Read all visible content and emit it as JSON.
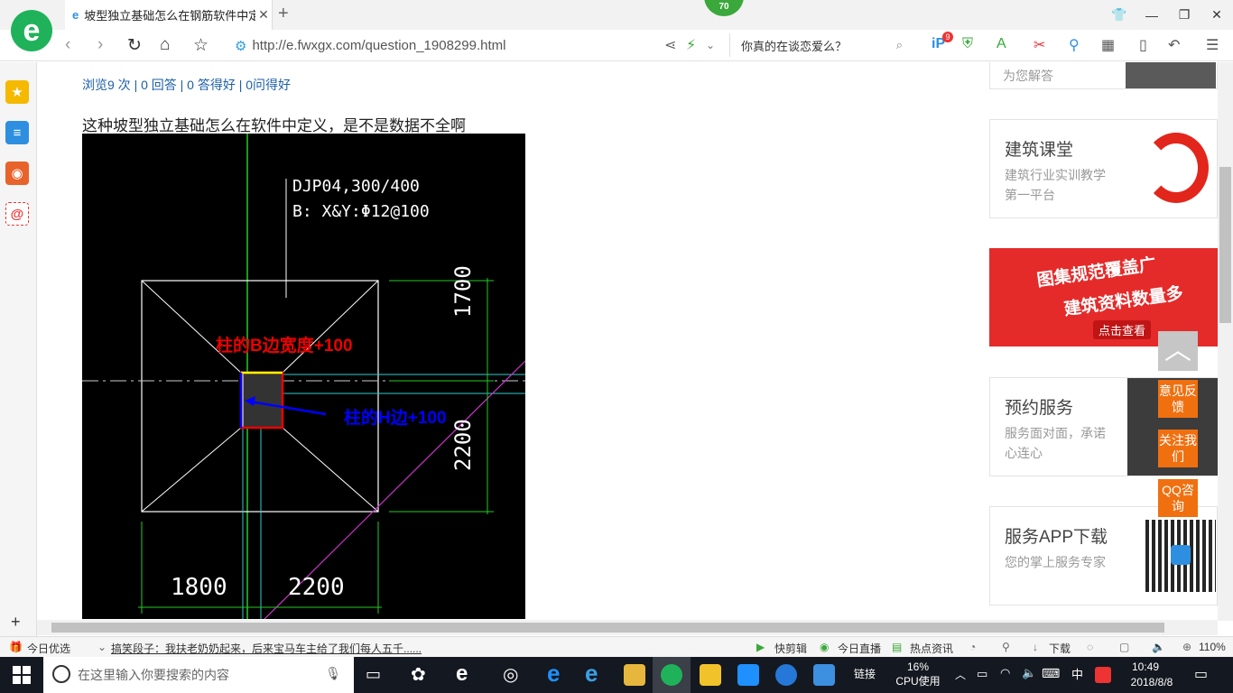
{
  "browser": {
    "tab_title": "坡型独立基础怎么在钢筋软件中定",
    "score_badge": "70",
    "url": "http://e.fwxgx.com/question_1908299.html",
    "search_placeholder": "你真的在谈恋爱么？",
    "notif_count": "9"
  },
  "page": {
    "stats": "浏览9 次 | 0 回答 | 0 答得好 | 0问得好",
    "question": "这种坡型独立基础怎么在软件中定义，是不是数据不全啊",
    "cad": {
      "label1": "DJP04,300/400",
      "label2": "B: X&Y:Φ12@100",
      "dim_top": "1700",
      "dim_bottom_right": "2200",
      "dim_left": "1800",
      "dim_right": "2200",
      "annot_red": "柱的B边宽度+100",
      "annot_blue": "柱的H边+100"
    }
  },
  "sidebar_right": {
    "top_partial": "为您解答",
    "card1": {
      "title": "建筑课堂",
      "desc": "建筑行业实训教学第一平台"
    },
    "banner": {
      "line1": "图集规范覆盖广",
      "line2": "建筑资料数量多",
      "cta": "点击查看"
    },
    "card2": {
      "title": "预约服务",
      "desc": "服务面对面，承诺心连心"
    },
    "card3": {
      "title": "服务APP下载",
      "desc": "您的掌上服务专家"
    }
  },
  "float_buttons": {
    "feedback": "意见反馈",
    "follow": "关注我们",
    "qq": "QQ咨询"
  },
  "statusbar": {
    "today": "今日优选",
    "news": "搞笑段子：我扶老奶奶起来，后来宝马车主给了我们每人五千......",
    "kuaijian": "快剪辑",
    "live": "今日直播",
    "hot": "热点资讯",
    "download": "下载",
    "zoom": "110%"
  },
  "taskbar": {
    "search_placeholder": "在这里输入你要搜索的内容",
    "link": "链接",
    "cpu_pct": "16%",
    "cpu_label": "CPU使用",
    "ime": "中",
    "time": "10:49",
    "date": "2018/8/8"
  }
}
